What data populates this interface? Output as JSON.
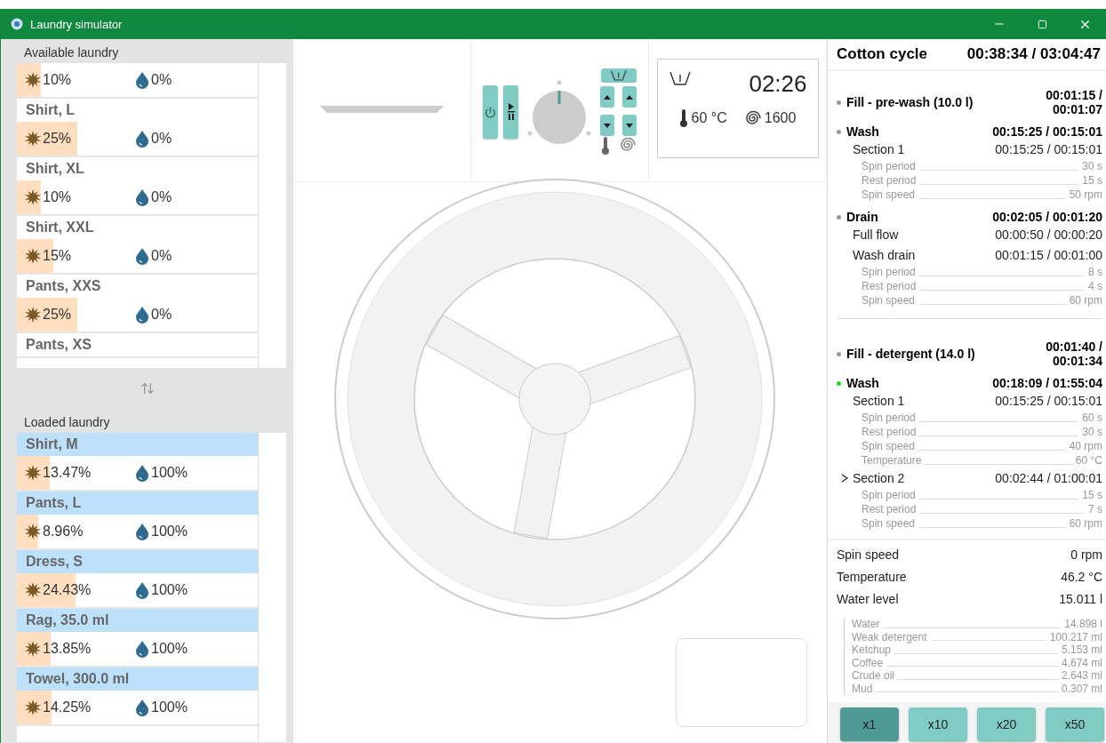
{
  "window": {
    "title": "Laundry simulator"
  },
  "laundry_lists": [
    {
      "title": "Available laundry",
      "loaded": false,
      "items": [
        {
          "dirt": "10%",
          "level": 0.1,
          "wetness": "0%"
        },
        {
          "name": "Shirt, L",
          "dirt": "25%",
          "level": 0.25,
          "wetness": "0%"
        },
        {
          "name": "Shirt, XL",
          "dirt": "10%",
          "level": 0.1,
          "wetness": "0%"
        },
        {
          "name": "Shirt, XXL",
          "dirt": "15%",
          "level": 0.15,
          "wetness": "0%"
        },
        {
          "name": "Pants, XXS",
          "dirt": "25%",
          "level": 0.25,
          "wetness": "0%"
        },
        {
          "name": "Pants, XS"
        }
      ]
    },
    {
      "title": "Loaded laundry",
      "loaded": true,
      "items": [
        {
          "name": "Shirt, M",
          "dirt": "13.47%",
          "level": 0.1347,
          "wetness": "100%"
        },
        {
          "name": "Pants, L",
          "dirt": "8.96%",
          "level": 0.0896,
          "wetness": "100%"
        },
        {
          "name": "Dress, S",
          "dirt": "24.43%",
          "level": 0.2443,
          "wetness": "100%"
        },
        {
          "name": "Rag, 35.0 ml",
          "dirt": "13.85%",
          "level": 0.1385,
          "wetness": "100%"
        },
        {
          "name": "Towel, 300.0 ml",
          "dirt": "14.25%",
          "level": 0.1425,
          "wetness": "100%"
        }
      ]
    }
  ],
  "display": {
    "time": "02:26",
    "temperature": "60 °C",
    "spin": "1600",
    "prewash": true
  },
  "cycle": {
    "title": "Cotton cycle",
    "time": "00:38:34 / 03:04:47",
    "phases": [
      {
        "stages": [
          {
            "name": "Fill - pre-wash (10.0 l)",
            "time": "00:01:15 / 00:01:07",
            "active": false
          },
          {
            "name": "Wash",
            "time": "00:15:25 / 00:15:01",
            "active": false,
            "children": [
              {
                "name": "Section 1",
                "time": "00:15:25 / 00:15:01",
                "current": false,
                "params": [
                  {
                    "label": "Spin period",
                    "value": "30 s"
                  },
                  {
                    "label": "Rest period",
                    "value": "15 s"
                  },
                  {
                    "label": "Spin speed",
                    "value": "50 rpm"
                  }
                ]
              }
            ]
          },
          {
            "name": "Drain",
            "time": "00:02:05 / 00:01:20",
            "active": false,
            "children": [
              {
                "name": "Full flow",
                "time": "00:00:50 / 00:00:20",
                "current": false
              },
              {
                "name": "Wash drain",
                "time": "00:01:15 / 00:01:00",
                "current": false,
                "params": [
                  {
                    "label": "Spin period",
                    "value": "8 s"
                  },
                  {
                    "label": "Rest period",
                    "value": "4 s"
                  },
                  {
                    "label": "Spin speed",
                    "value": "60 rpm"
                  }
                ]
              }
            ]
          }
        ]
      },
      {
        "stages": [
          {
            "name": "Fill - detergent (14.0 l)",
            "time": "00:01:40 / 00:01:34",
            "active": false
          },
          {
            "name": "Wash",
            "time": "00:18:09 / 01:55:04",
            "active": true,
            "children": [
              {
                "name": "Section 1",
                "time": "00:15:25 / 00:15:01",
                "current": false,
                "params": [
                  {
                    "label": "Spin period",
                    "value": "60 s"
                  },
                  {
                    "label": "Rest period",
                    "value": "30 s"
                  },
                  {
                    "label": "Spin speed",
                    "value": "40 rpm"
                  },
                  {
                    "label": "Temperature",
                    "value": "60 °C"
                  }
                ]
              },
              {
                "name": "Section 2",
                "time": "00:02:44 / 01:00:01",
                "current": true,
                "params": [
                  {
                    "label": "Spin period",
                    "value": "15 s"
                  },
                  {
                    "label": "Rest period",
                    "value": "7 s"
                  },
                  {
                    "label": "Spin speed",
                    "value": "60 rpm"
                  }
                ]
              }
            ]
          }
        ]
      }
    ]
  },
  "readings": [
    {
      "label": "Spin speed",
      "value": "0 rpm"
    },
    {
      "label": "Temperature",
      "value": "46.2 °C"
    },
    {
      "label": "Water level",
      "value": "15.011 l"
    }
  ],
  "contents": [
    {
      "label": "Water",
      "value": "14.898 l"
    },
    {
      "label": "Weak detergent",
      "value": "100.217 ml"
    },
    {
      "label": "Ketchup",
      "value": "5.153 ml"
    },
    {
      "label": "Coffee",
      "value": "4.674 ml"
    },
    {
      "label": "Crude oil",
      "value": "2.643 ml"
    },
    {
      "label": "Mud",
      "value": "0.307 ml"
    }
  ],
  "speed_buttons": [
    {
      "label": "x1",
      "selected": true
    },
    {
      "label": "x10",
      "selected": false
    },
    {
      "label": "x20",
      "selected": false
    },
    {
      "label": "x50",
      "selected": false
    }
  ]
}
